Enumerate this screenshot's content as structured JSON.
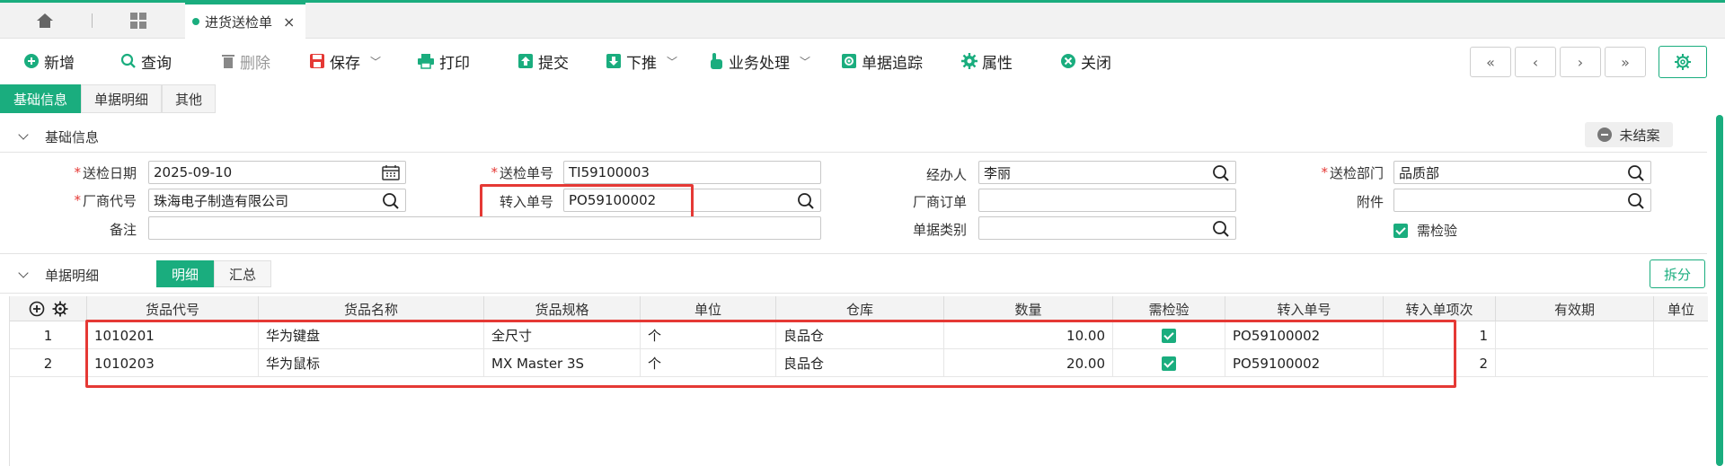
{
  "colors": {
    "accent": "#1aad7e",
    "highlight": "#e53935"
  },
  "tabbar": {
    "doc_tab_label": "进货送检单",
    "close": "×"
  },
  "toolbar": {
    "new": "新增",
    "query": "查询",
    "delete": "删除",
    "save": "保存",
    "print": "打印",
    "submit": "提交",
    "push_down": "下推",
    "business": "业务处理",
    "trace": "单据追踪",
    "props": "属性",
    "close": "关闭"
  },
  "subtabs": [
    "基础信息",
    "单据明细",
    "其他"
  ],
  "basic": {
    "title": "基础信息",
    "status": "未结案",
    "inspect_date_label": "送检日期",
    "inspect_date": "2025-09-10",
    "inspect_no_label": "送检单号",
    "inspect_no": "TI59100003",
    "handler_label": "经办人",
    "handler": "李丽",
    "dept_label": "送检部门",
    "dept": "品质部",
    "vendor_label": "厂商代号",
    "vendor": "珠海电子制造有限公司",
    "transfer_no_label": "转入单号",
    "transfer_no": "PO59100002",
    "vendor_order_label": "厂商订单",
    "vendor_order": "",
    "attach_label": "附件",
    "attach": "",
    "remark_label": "备注",
    "remark": "",
    "doc_type_label": "单据类别",
    "doc_type": "",
    "need_inspect_label": "需检验"
  },
  "detail": {
    "title": "单据明细",
    "tabs": [
      "明细",
      "汇总"
    ],
    "split": "拆分",
    "columns": [
      "货品代号",
      "货品名称",
      "货品规格",
      "单位",
      "仓库",
      "数量",
      "需检验",
      "转入单号",
      "转入单项次",
      "有效期",
      "单位"
    ],
    "rows": [
      {
        "idx": "1",
        "code": "1010201",
        "name": "华为键盘",
        "spec": "全尺寸",
        "unit": "个",
        "warehouse": "良品仓",
        "qty": "10.00",
        "inspect": true,
        "transfer_no": "PO59100002",
        "transfer_item": "1",
        "expiry": "",
        "unit2": ""
      },
      {
        "idx": "2",
        "code": "1010203",
        "name": "华为鼠标",
        "spec": "MX Master 3S",
        "unit": "个",
        "warehouse": "良品仓",
        "qty": "20.00",
        "inspect": true,
        "transfer_no": "PO59100002",
        "transfer_item": "2",
        "expiry": "",
        "unit2": ""
      }
    ]
  }
}
